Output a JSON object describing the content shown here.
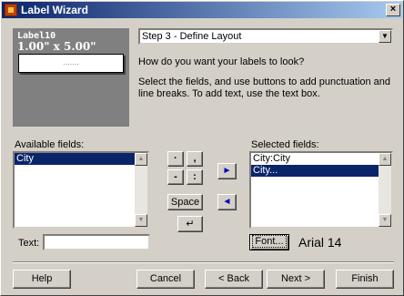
{
  "window": {
    "title": "Label Wizard",
    "close": "×",
    "app_icon": "label-wizard-icon"
  },
  "preview": {
    "name": "Label10",
    "size": "1.00\" x 5.00\"",
    "content": "......."
  },
  "step_select": {
    "value": "Step 3 - Define Layout",
    "arrow": "▼"
  },
  "question": "How do you want your labels to look?",
  "description": "Select the fields, and use buttons to add punctuation and line breaks. To add text, use the text box.",
  "available": {
    "label": "Available fields:",
    "items": [
      "City"
    ],
    "selected_index": 0
  },
  "selected": {
    "label": "Selected fields:",
    "items": [
      "City:City",
      "City..."
    ],
    "selected_index": 1
  },
  "punct": {
    "period": "·",
    "comma": ",",
    "hyphen": "-",
    "colon": ":",
    "space": "Space",
    "newline": "↵"
  },
  "move": {
    "add": "►",
    "remove": "◄"
  },
  "scroll": {
    "up": "▲",
    "down": "▼"
  },
  "text_field": {
    "label": "Text:",
    "value": ""
  },
  "font": {
    "button": "Font...",
    "current": "Arial 14"
  },
  "buttons": {
    "help": "Help",
    "cancel": "Cancel",
    "back": "< Back",
    "next": "Next >",
    "finish": "Finish"
  }
}
